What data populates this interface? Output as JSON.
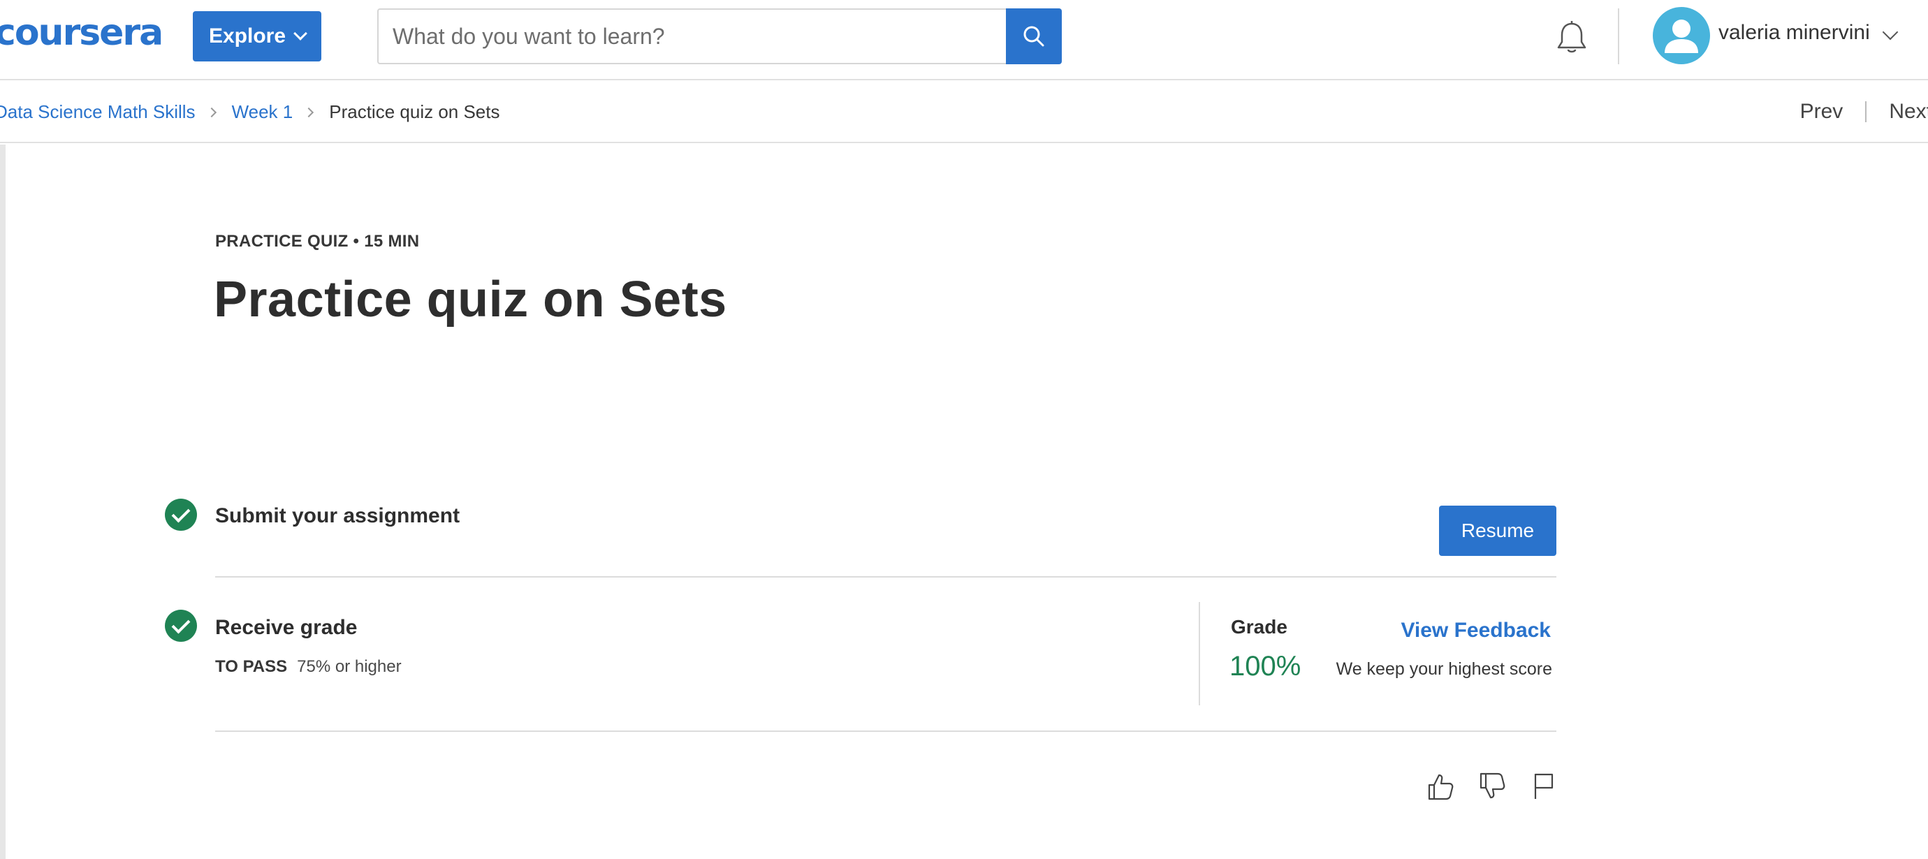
{
  "header": {
    "logo_text": "coursera",
    "explore_label": "Explore",
    "search": {
      "placeholder": "What do you want to learn?",
      "value": ""
    },
    "user_name": "valeria minervini",
    "icons": [
      "bell-icon",
      "search-icon",
      "avatar-icon",
      "chevron-down-icon"
    ]
  },
  "breadcrumb": {
    "items": [
      "Data Science Math Skills",
      "Week 1"
    ],
    "current": "Practice quiz on Sets"
  },
  "pagination": {
    "prev": "Prev",
    "next": "Next"
  },
  "main": {
    "meta": "PRACTICE QUIZ • 15 MIN",
    "title": "Practice quiz on Sets",
    "submit": {
      "title": "Submit your assignment",
      "button": "Resume"
    },
    "receive": {
      "title": "Receive grade",
      "to_pass_label": "TO PASS",
      "to_pass_value": "75% or higher"
    },
    "grade": {
      "label": "Grade",
      "value": "100%",
      "view_feedback": "View Feedback",
      "note": "We keep your highest score"
    },
    "feedback_icons": [
      "thumbs-up-icon",
      "thumbs-down-icon",
      "flag-icon"
    ]
  },
  "colors": {
    "brand_blue": "#2a73cc",
    "success_green": "#1f8354",
    "avatar_blue": "#48b4dc"
  }
}
